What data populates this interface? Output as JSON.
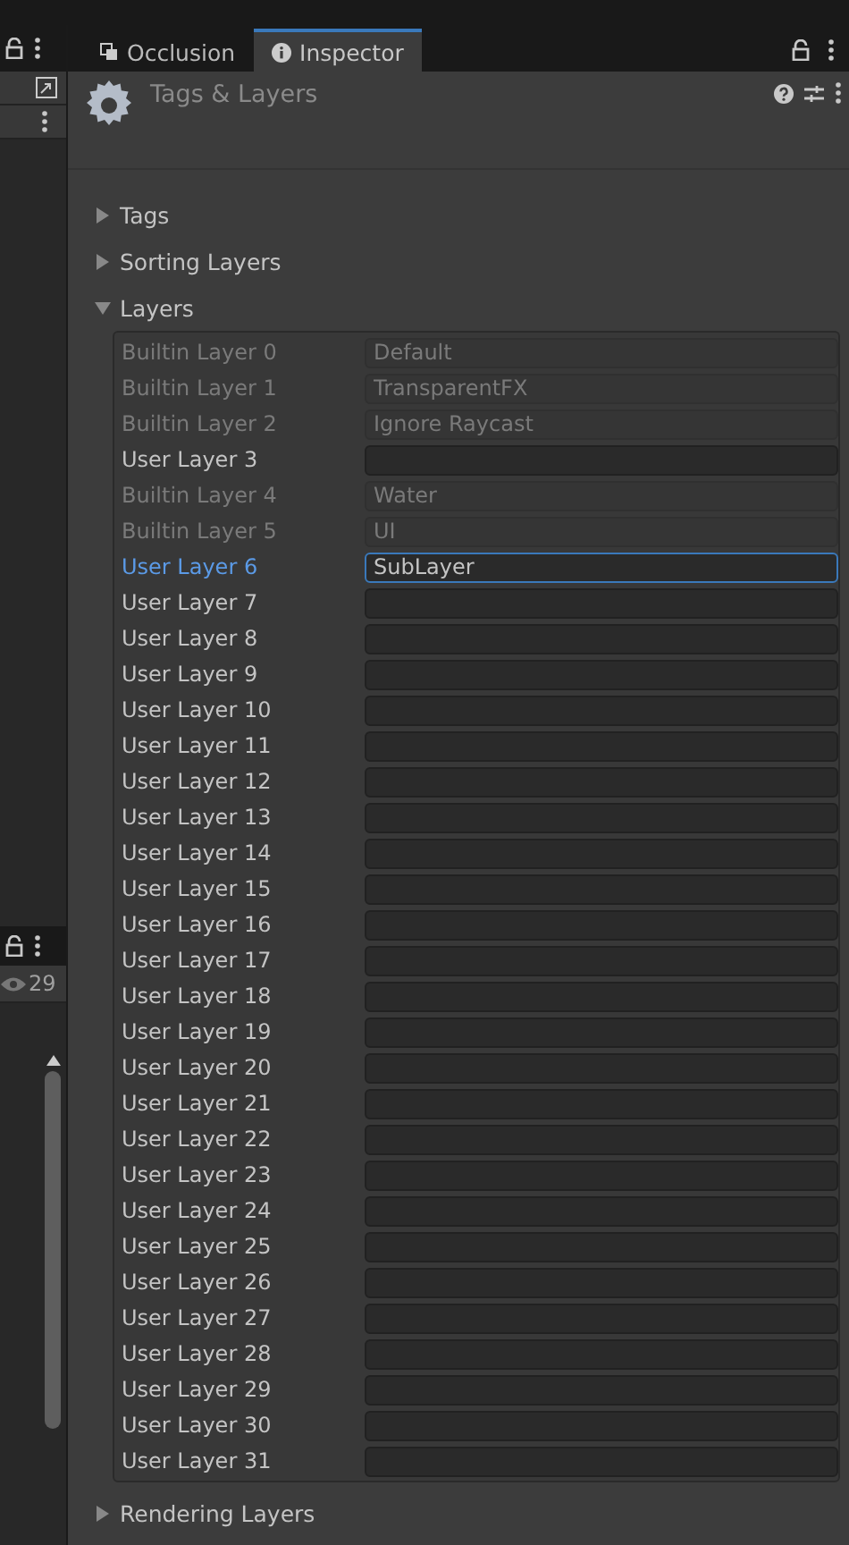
{
  "tabs": [
    {
      "label": "Occlusion",
      "selected": false
    },
    {
      "label": "Inspector",
      "selected": true
    }
  ],
  "left_panel": {
    "visible_count": "29"
  },
  "header": {
    "title": "Tags & Layers"
  },
  "sections": [
    {
      "label": "Tags",
      "expanded": false
    },
    {
      "label": "Sorting Layers",
      "expanded": false
    },
    {
      "label": "Layers",
      "expanded": true,
      "layers": [
        {
          "label": "Builtin Layer 0",
          "value": "Default",
          "disabled": true,
          "selected": false
        },
        {
          "label": "Builtin Layer 1",
          "value": "TransparentFX",
          "disabled": true,
          "selected": false
        },
        {
          "label": "Builtin Layer 2",
          "value": "Ignore Raycast",
          "disabled": true,
          "selected": false
        },
        {
          "label": "User Layer 3",
          "disabled": false,
          "selected": false
        },
        {
          "label": "Builtin Layer 4",
          "value": "Water",
          "disabled": true,
          "selected": false
        },
        {
          "label": "Builtin Layer 5",
          "value": "UI",
          "disabled": true,
          "selected": false
        },
        {
          "label": "User Layer 6",
          "value": "SubLayer",
          "disabled": false,
          "selected": true
        },
        {
          "label": "User Layer 7",
          "disabled": false,
          "selected": false
        },
        {
          "label": "User Layer 8",
          "disabled": false,
          "selected": false
        },
        {
          "label": "User Layer 9",
          "disabled": false,
          "selected": false
        },
        {
          "label": "User Layer 10",
          "disabled": false,
          "selected": false
        },
        {
          "label": "User Layer 11",
          "disabled": false,
          "selected": false
        },
        {
          "label": "User Layer 12",
          "disabled": false,
          "selected": false
        },
        {
          "label": "User Layer 13",
          "disabled": false,
          "selected": false
        },
        {
          "label": "User Layer 14",
          "disabled": false,
          "selected": false
        },
        {
          "label": "User Layer 15",
          "disabled": false,
          "selected": false
        },
        {
          "label": "User Layer 16",
          "disabled": false,
          "selected": false
        },
        {
          "label": "User Layer 17",
          "disabled": false,
          "selected": false
        },
        {
          "label": "User Layer 18",
          "disabled": false,
          "selected": false
        },
        {
          "label": "User Layer 19",
          "disabled": false,
          "selected": false
        },
        {
          "label": "User Layer 20",
          "disabled": false,
          "selected": false
        },
        {
          "label": "User Layer 21",
          "disabled": false,
          "selected": false
        },
        {
          "label": "User Layer 22",
          "disabled": false,
          "selected": false
        },
        {
          "label": "User Layer 23",
          "disabled": false,
          "selected": false
        },
        {
          "label": "User Layer 24",
          "disabled": false,
          "selected": false
        },
        {
          "label": "User Layer 25",
          "disabled": false,
          "selected": false
        },
        {
          "label": "User Layer 26",
          "disabled": false,
          "selected": false
        },
        {
          "label": "User Layer 27",
          "disabled": false,
          "selected": false
        },
        {
          "label": "User Layer 28",
          "disabled": false,
          "selected": false
        },
        {
          "label": "User Layer 29",
          "disabled": false,
          "selected": false
        },
        {
          "label": "User Layer 30",
          "disabled": false,
          "selected": false
        },
        {
          "label": "User Layer 31",
          "disabled": false,
          "selected": false
        }
      ]
    },
    {
      "label": "Rendering Layers",
      "expanded": false
    }
  ]
}
